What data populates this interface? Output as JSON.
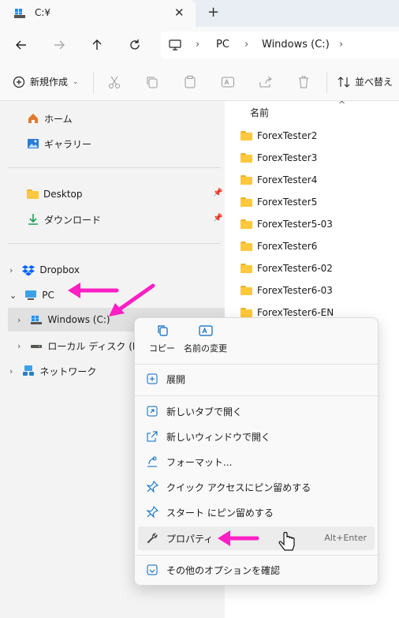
{
  "window": {
    "tab_title": "C:¥"
  },
  "address": {
    "pc": "PC",
    "drive": "Windows (C:)"
  },
  "command_bar": {
    "new_label": "新規作成",
    "sort_label": "並べ替え"
  },
  "nav_pane": {
    "home": "ホーム",
    "gallery": "ギャラリー",
    "desktop": "Desktop",
    "downloads": "ダウンロード",
    "dropbox": "Dropbox",
    "pc": "PC",
    "windows_c": "Windows (C:)",
    "local_d": "ローカル ディスク (D:)",
    "network": "ネットワーク"
  },
  "content": {
    "column_name": "名前",
    "folders": [
      "ForexTester2",
      "ForexTester3",
      "ForexTester4",
      "ForexTester5",
      "ForexTester5-03",
      "ForexTester6",
      "ForexTester6-02",
      "ForexTester6-03",
      "ForexTester6-EN"
    ]
  },
  "context_menu": {
    "copy": "コピー",
    "rename": "名前の変更",
    "expand": "展開",
    "open_new_tab": "新しいタブで開く",
    "open_new_window": "新しいウィンドウで開く",
    "format": "フォーマット...",
    "pin_quick_access": "クイック アクセスにピン留めする",
    "pin_start": "スタート にピン留めする",
    "properties": "プロパティ",
    "properties_shortcut": "Alt+Enter",
    "more_options": "その他のオプションを確認"
  },
  "colors": {
    "annotation_arrow": "#ff1fc4",
    "folder": "#ffc83d",
    "accent": "#0067c0"
  }
}
